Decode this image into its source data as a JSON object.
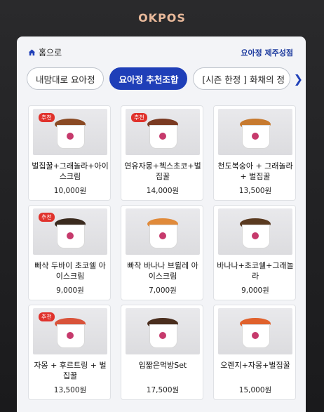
{
  "device": {
    "brand": "OKPOS"
  },
  "header": {
    "home_label": "홈으로",
    "store_label": "요아정 제주성점"
  },
  "tabs": [
    {
      "label": "내맘대로 요아정",
      "active": false
    },
    {
      "label": "요아정 추천조합",
      "active": true
    },
    {
      "label": "[시즌 한정 ] 화채의 정",
      "active": false
    }
  ],
  "menu": [
    {
      "name": "벌집꿀+그래놀라+아이스크림",
      "price": "10,000원",
      "badge": "추천",
      "topping": "#8a4a24"
    },
    {
      "name": "연유자몽+첵스초코+벌집꿀",
      "price": "14,000원",
      "badge": "추천",
      "topping": "#7a3a22"
    },
    {
      "name": "천도복숭아 + 그래놀라 + 벌집꿀",
      "price": "13,500원",
      "badge": "",
      "topping": "#c77a2f"
    },
    {
      "name": "빠삭 두바이 초코쉘 아이스크림",
      "price": "9,000원",
      "badge": "추천",
      "topping": "#3a2a1e"
    },
    {
      "name": "빠작 바나나 브륄레 아이스크림",
      "price": "7,000원",
      "badge": "",
      "topping": "#e08a3a"
    },
    {
      "name": "바나나+초코쉘+그래놀라",
      "price": "9,000원",
      "badge": "",
      "topping": "#5a3a20"
    },
    {
      "name": "자몽 + 후르트링 + 벌집꿀",
      "price": "13,500원",
      "badge": "추천",
      "topping": "#d9533a"
    },
    {
      "name": "입짧은먹방Set",
      "price": "17,500원",
      "badge": "",
      "topping": "#4a2e1e"
    },
    {
      "name": "오렌지+자몽+벌집꿀",
      "price": "15,000원",
      "badge": "",
      "topping": "#e0612c"
    }
  ]
}
